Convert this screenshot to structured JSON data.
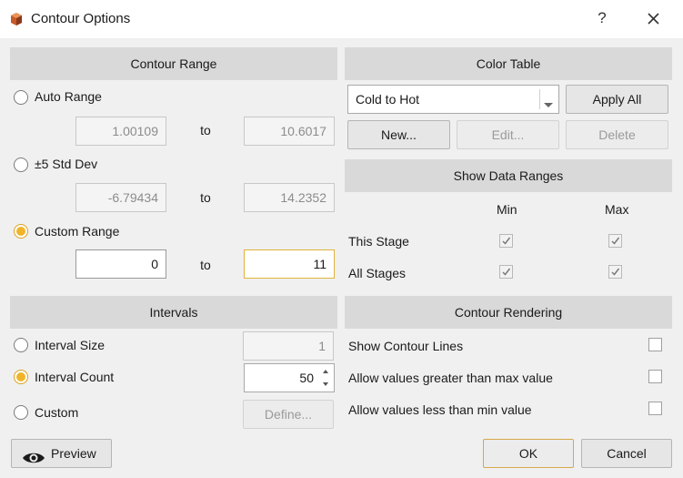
{
  "window": {
    "title": "Contour Options",
    "help": "?"
  },
  "contour_range": {
    "header": "Contour Range",
    "auto": {
      "label": "Auto Range",
      "from": "1.00109",
      "to": "10.6017",
      "checked": false
    },
    "stddev": {
      "label": "±5 Std Dev",
      "from": "-6.79434",
      "to": "14.2352",
      "checked": false
    },
    "custom": {
      "label": "Custom Range",
      "from": "0",
      "to": "11",
      "checked": true
    },
    "to_label": "to"
  },
  "color_table": {
    "header": "Color Table",
    "selected": "Cold to Hot",
    "apply_all": "Apply All",
    "new": "New...",
    "edit": "Edit...",
    "delete": "Delete"
  },
  "show_data_ranges": {
    "header": "Show Data Ranges",
    "col_min": "Min",
    "col_max": "Max",
    "rows": [
      {
        "label": "This Stage",
        "min": true,
        "max": true
      },
      {
        "label": "All Stages",
        "min": true,
        "max": true
      }
    ]
  },
  "intervals": {
    "header": "Intervals",
    "interval_size": {
      "label": "Interval Size",
      "value": "1",
      "checked": false
    },
    "interval_count": {
      "label": "Interval Count",
      "value": "50",
      "checked": true
    },
    "custom": {
      "label": "Custom",
      "button": "Define...",
      "checked": false
    }
  },
  "contour_rendering": {
    "header": "Contour Rendering",
    "options": [
      {
        "label": "Show Contour Lines",
        "checked": false
      },
      {
        "label": "Allow values greater than max value",
        "checked": false
      },
      {
        "label": "Allow values less than min value",
        "checked": false
      }
    ]
  },
  "footer": {
    "preview": "Preview",
    "ok": "OK",
    "cancel": "Cancel"
  },
  "colors": {
    "accent": "#f0b429",
    "header_bg": "#d9d9d9",
    "dialog_bg": "#f0f0f0"
  },
  "icons": [
    "app-icon",
    "help-icon",
    "close-icon",
    "eye-icon",
    "dropdown-arrow-icon",
    "spin-up-icon",
    "spin-down-icon",
    "checkmark-icon"
  ]
}
